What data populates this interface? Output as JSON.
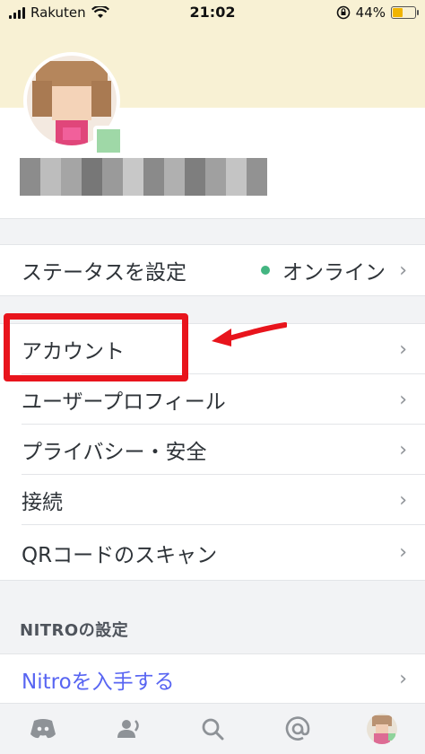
{
  "status_bar": {
    "carrier": "Rakuten",
    "time": "21:02",
    "battery_percent": "44%",
    "battery_level": 0.44
  },
  "status_row": {
    "label": "ステータスを設定",
    "value": "オンライン",
    "status_color": "#43b581"
  },
  "menu_items": [
    {
      "label": "アカウント"
    },
    {
      "label": "ユーザープロフィール"
    },
    {
      "label": "プライバシー・安全"
    },
    {
      "label": "接続"
    },
    {
      "label": "QRコードのスキャン"
    }
  ],
  "nitro_section": {
    "header": "NITROの設定",
    "item_label": "Nitroを入手する",
    "accent_color": "#5865f2"
  },
  "annotation": {
    "highlight_color": "#e8141c"
  },
  "tabbar": {
    "tabs": [
      "discord-home-icon",
      "friends-icon",
      "search-icon",
      "mentions-icon",
      "profile-avatar"
    ]
  }
}
